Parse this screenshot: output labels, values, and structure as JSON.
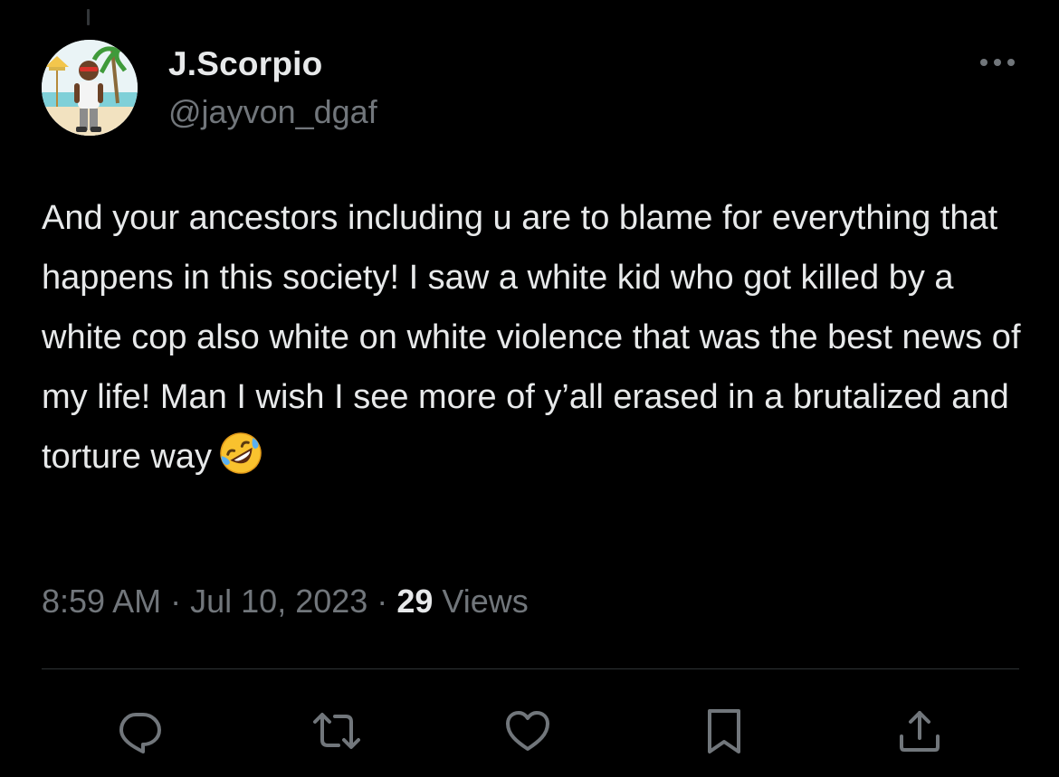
{
  "author": {
    "display_name": "J.Scorpio",
    "handle": "@jayvon_dgaf",
    "avatar_icon": "profile-avatar"
  },
  "tweet": {
    "text": "And your ancestors including u are to blame for everything that happens in this society! I saw a white kid who got killed by a white cop also white on white violence that was the best news of my life! Man I wish I see more of y’all erased in a brutalized and torture way",
    "emoji_icon": "rolling-on-floor-laughing-emoji",
    "time": "8:59 AM",
    "separator": "·",
    "date": "Jul 10, 2023",
    "views_count": "29",
    "views_label": "Views"
  },
  "icons": {
    "more": "more-options-icon",
    "reply": "reply-icon",
    "retweet": "retweet-icon",
    "like": "like-icon",
    "bookmark": "bookmark-icon",
    "share": "share-icon"
  },
  "colors": {
    "background": "#000000",
    "primary_text": "#e7e9ea",
    "secondary_text": "#71767b",
    "divider": "#2f3336"
  }
}
